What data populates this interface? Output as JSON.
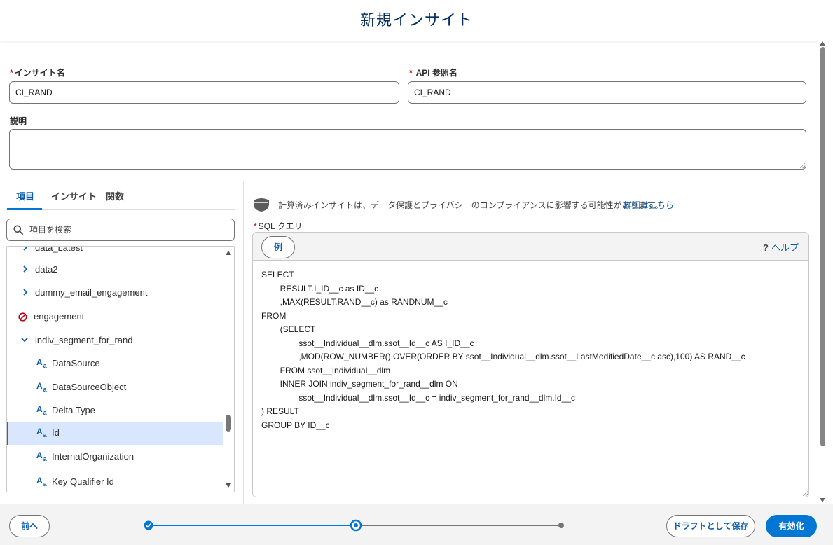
{
  "header": {
    "title": "新規インサイト"
  },
  "form": {
    "required_mark": "*",
    "insight_name": {
      "label": "インサイト名",
      "value": "CI_RAND"
    },
    "api_name": {
      "label": "API 参照名",
      "value": "CI_RAND"
    },
    "description": {
      "label": "説明",
      "value": ""
    }
  },
  "left_panel": {
    "tabs": [
      {
        "label": "項目",
        "active": true
      },
      {
        "label": "インサイト",
        "active": false
      },
      {
        "label": "関数",
        "active": false
      }
    ],
    "search_placeholder": "項目を検索",
    "tree": [
      {
        "label": "data_Latest",
        "type": "collapsed"
      },
      {
        "label": "data2",
        "type": "collapsed"
      },
      {
        "label": "dummy_email_engagement",
        "type": "collapsed"
      },
      {
        "label": "engagement",
        "type": "disabled"
      },
      {
        "label": "indiv_segment_for_rand",
        "type": "expanded"
      },
      {
        "label": "DataSource",
        "type": "text-field"
      },
      {
        "label": "DataSourceObject",
        "type": "text-field"
      },
      {
        "label": "Delta Type",
        "type": "text-field"
      },
      {
        "label": "Id",
        "type": "text-field",
        "selected": true
      },
      {
        "label": "InternalOrganization",
        "type": "text-field"
      },
      {
        "label": "Key Qualifier Id",
        "type": "text-field"
      }
    ],
    "text_field_glyph": "A",
    "text_field_glyph_sub": "a"
  },
  "right_panel": {
    "notice": "計算済みインサイトは、データ保護とプライバシーのコンプライアンスに影響する可能性があります。",
    "notice_link": "詳細はこちら",
    "sql_label": "SQL クエリ",
    "example_button": "例",
    "help_label": "ヘルプ",
    "help_glyph": "?",
    "sql": "SELECT\n        RESULT.I_ID__c as ID__c\n        ,MAX(RESULT.RAND__c) as RANDNUM__c\nFROM\n        (SELECT\n                ssot__Individual__dlm.ssot__Id__c AS I_ID__c\n                ,MOD(ROW_NUMBER() OVER(ORDER BY ssot__Individual__dlm.ssot__LastModifiedDate__c asc),100) AS RAND__c\n        FROM ssot__Individual__dlm\n        INNER JOIN indiv_segment_for_rand__dlm ON\n                ssot__Individual__dlm.ssot__Id__c = indiv_segment_for_rand__dlm.Id__c\n) RESULT\nGROUP BY ID__c"
  },
  "footer": {
    "back_button": "前へ",
    "draft_button": "ドラフトとして保存",
    "activate_button": "有効化",
    "progress": {
      "steps": 3,
      "completed": 1,
      "current": 2
    }
  },
  "colors": {
    "brand": "#0176d3",
    "title": "#032d60",
    "required": "#ba0517",
    "link": "#0b5cab"
  }
}
